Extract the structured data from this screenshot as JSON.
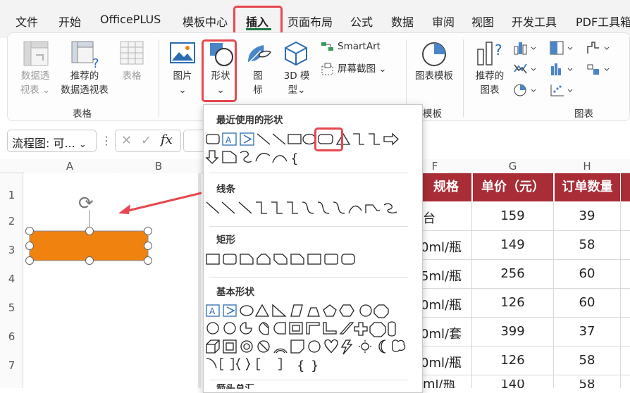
{
  "menu": {
    "items": [
      "文件",
      "开始",
      "OfficePLUS",
      "模板中心",
      "插入",
      "页面布局",
      "公式",
      "数据",
      "审阅",
      "视图",
      "开发工具",
      "PDF工具箱"
    ],
    "active": "插入"
  },
  "ribbon": {
    "tables_group": {
      "name": "表格",
      "pivot_table": [
        "数据透",
        "视表"
      ],
      "recommended_pivot": [
        "推荐的",
        "数据透视表"
      ],
      "table": "表格"
    },
    "illustrations": {
      "picture": "图片",
      "shapes": "形状",
      "icons": [
        "图",
        "标"
      ],
      "model3d": [
        "3D 模",
        "型"
      ],
      "smartart": "SmartArt",
      "screenshot": "屏幕截图"
    },
    "template_group": {
      "label": "图表模板",
      "name": "模板"
    },
    "charts_group": {
      "recommended": [
        "推荐的",
        "图表"
      ],
      "name": "图表"
    }
  },
  "formula_bar": {
    "name_box": "流程图: 可...",
    "fx": "fx"
  },
  "grid": {
    "columns": [
      "A",
      "B",
      "F",
      "G",
      "H"
    ],
    "rows": [
      "1",
      "2",
      "3",
      "4",
      "5",
      "6",
      "7"
    ],
    "table_headers": [
      "规格",
      "单价（元）",
      "订单数量"
    ],
    "table_rows": [
      [
        "台",
        "159",
        "39"
      ],
      [
        "0ml/瓶",
        "149",
        "58"
      ],
      [
        "5ml/瓶",
        "256",
        "60"
      ],
      [
        "0ml/瓶",
        "126",
        "60"
      ],
      [
        "0ml/套",
        "399",
        "37"
      ],
      [
        "0ml/瓶",
        "126",
        "58"
      ],
      [
        "ml/瓶",
        "140",
        "58"
      ]
    ]
  },
  "shapes_menu": {
    "recent": "最近使用的形状",
    "lines": "线条",
    "rectangles": "矩形",
    "basic": "基本形状",
    "arrows": "箭头总汇",
    "text_box_glyphs": [
      "A",
      "A"
    ]
  },
  "colors": {
    "accent_red": "#e8474f",
    "header_fill": "#a82d36",
    "shape_fill": "#f0830f",
    "active_tab": "#1f7a44"
  }
}
